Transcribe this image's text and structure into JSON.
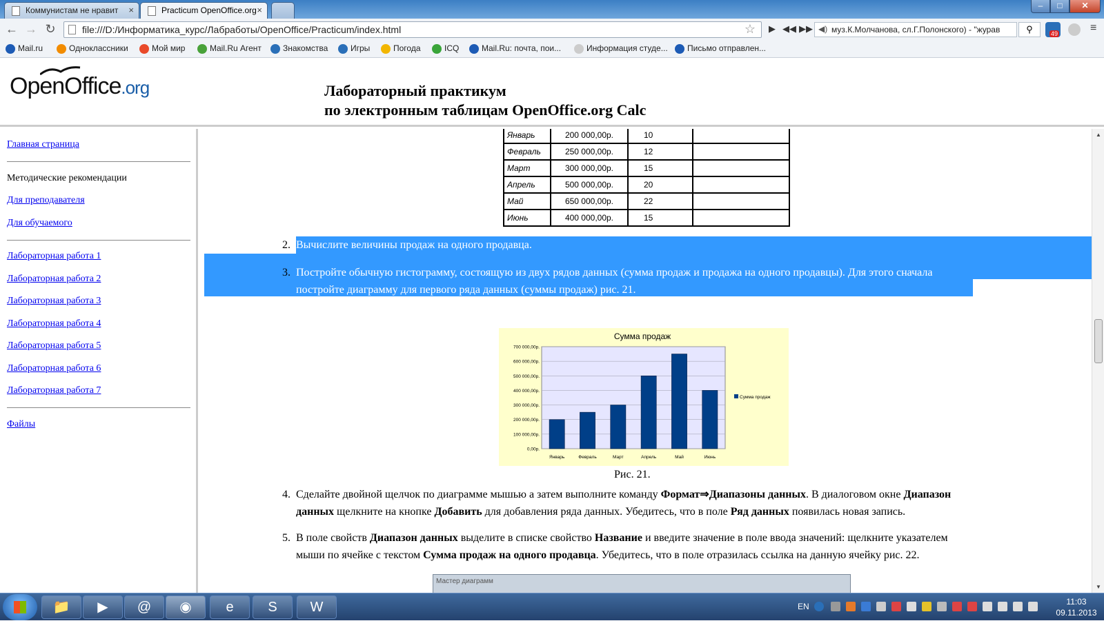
{
  "browser": {
    "tabs": [
      {
        "label": "Коммунистам не нравит",
        "active": false
      },
      {
        "label": "Practicum OpenOffice.org",
        "active": true
      }
    ],
    "url": "file:///D:/Информатика_курс/Лабработы/OpenOffice/Practicum/index.html",
    "media_text": "муз.К.Молчанова, сл.Г.Полонского) - \"журав",
    "ext_badge": "49",
    "bookmarks": [
      {
        "label": "Mail.ru",
        "color": "#1d5bb5"
      },
      {
        "label": "Одноклассники",
        "color": "#f28c00"
      },
      {
        "label": "Мой мир",
        "color": "#e94a2a"
      },
      {
        "label": "Mail.Ru Агент",
        "color": "#49a23a"
      },
      {
        "label": "Знакомства",
        "color": "#2a6fb8"
      },
      {
        "label": "Игры",
        "color": "#2a6fb8"
      },
      {
        "label": "Погода",
        "color": "#f2b600"
      },
      {
        "label": "ICQ",
        "color": "#3aa53a"
      },
      {
        "label": "Mail.Ru: почта, пои...",
        "color": "#1d5bb5"
      },
      {
        "label": "Информация студе...",
        "color": "#cccccc"
      },
      {
        "label": "Письмо отправлен...",
        "color": "#1d5bb5"
      }
    ]
  },
  "header": {
    "logo_main": "OpenOffice",
    "logo_org": ".org",
    "title_line1": "Лабораторный практикум",
    "title_line2": "по электронным таблицам OpenOffice.org Calc"
  },
  "sidebar": {
    "home": "Главная страница",
    "methods": "Методические рекомендации",
    "teacher": "Для преподавателя",
    "student": "Для обучаемого",
    "labs": [
      "Лабораторная работа 1",
      "Лабораторная работа 2",
      "Лабораторная работа 3",
      "Лабораторная работа 4",
      "Лабораторная работа 5",
      "Лабораторная работа 6",
      "Лабораторная работа 7"
    ],
    "files": "Файлы"
  },
  "table": {
    "rows": [
      [
        "Январь",
        "200 000,00р.",
        "10",
        ""
      ],
      [
        "Февраль",
        "250 000,00р.",
        "12",
        ""
      ],
      [
        "Март",
        "300 000,00р.",
        "15",
        ""
      ],
      [
        "Апрель",
        "500 000,00р.",
        "20",
        ""
      ],
      [
        "Май",
        "650 000,00р.",
        "22",
        ""
      ],
      [
        "Июнь",
        "400 000,00р.",
        "15",
        ""
      ]
    ]
  },
  "steps": {
    "s2_num": "2.",
    "s2": "Вычислите величины продаж на одного продавца.",
    "s3_num": "3.",
    "s3_line1": "Постройте обычную гистограмму, состоящую из двух рядов данных (сумма продаж и продажа на одного продавцы). Для этого сначала",
    "s3_line2": "постройте диаграмму для первого ряда данных (суммы продаж) рис. 21.",
    "figure_caption": "Рис. 21.",
    "s4_num": "4.",
    "s4_a": "Сделайте двойной щелчок по диаграмме мышью а затем выполните команду ",
    "s4_b": "Формат⇒Диапазоны данных",
    "s4_c": ". В диалоговом окне ",
    "s4_d": "Диапазон",
    "s4_e": "данных",
    "s4_f": " щелкните на кнопке ",
    "s4_g": "Добавить",
    "s4_h": " для добавления ряда данных. Убедитесь, что в поле ",
    "s4_i": "Ряд данных",
    "s4_j": " появилась новая запись.",
    "s5_num": "5.",
    "s5_a": "В поле свойств ",
    "s5_b": "Диапазон данных",
    "s5_c": " выделите в списке свойство ",
    "s5_d": "Название",
    "s5_e": " и введите значение в поле ввода значений: щелкните указателем",
    "s5_f": "мыши по ячейке с текстом ",
    "s5_g": "Сумма продаж на одного продавца",
    "s5_h": ". Убедитесь, что в поле отразилась ссылка на данную ячейку рис. 22.",
    "next_dialog_title": "Мастер диаграмм"
  },
  "chart_data": {
    "type": "bar",
    "title": "Сумма продаж",
    "categories": [
      "Январь",
      "Февраль",
      "Март",
      "Апрель",
      "Май",
      "Июнь"
    ],
    "series": [
      {
        "name": "Сумма продаж",
        "values": [
          200000,
          250000,
          300000,
          500000,
          650000,
          400000
        ],
        "color": "#003f88"
      }
    ],
    "ylim": [
      0,
      700000
    ],
    "yticks": [
      "0,00р.",
      "100 000,00р.",
      "200 000,00р.",
      "300 000,00р.",
      "400 000,00р.",
      "500 000,00р.",
      "600 000,00р.",
      "700 000,00р."
    ],
    "grid": true,
    "legend": "right",
    "plot_bg": "#e6e6ff",
    "chart_bg": "#ffffcc"
  },
  "taskbar": {
    "lang": "EN",
    "time": "11:03",
    "date": "09.11.2013",
    "apps": [
      "explorer-icon",
      "media-player-icon",
      "mail-agent-icon",
      "chrome-icon",
      "ie-icon",
      "skype-icon",
      "word-icon"
    ]
  }
}
